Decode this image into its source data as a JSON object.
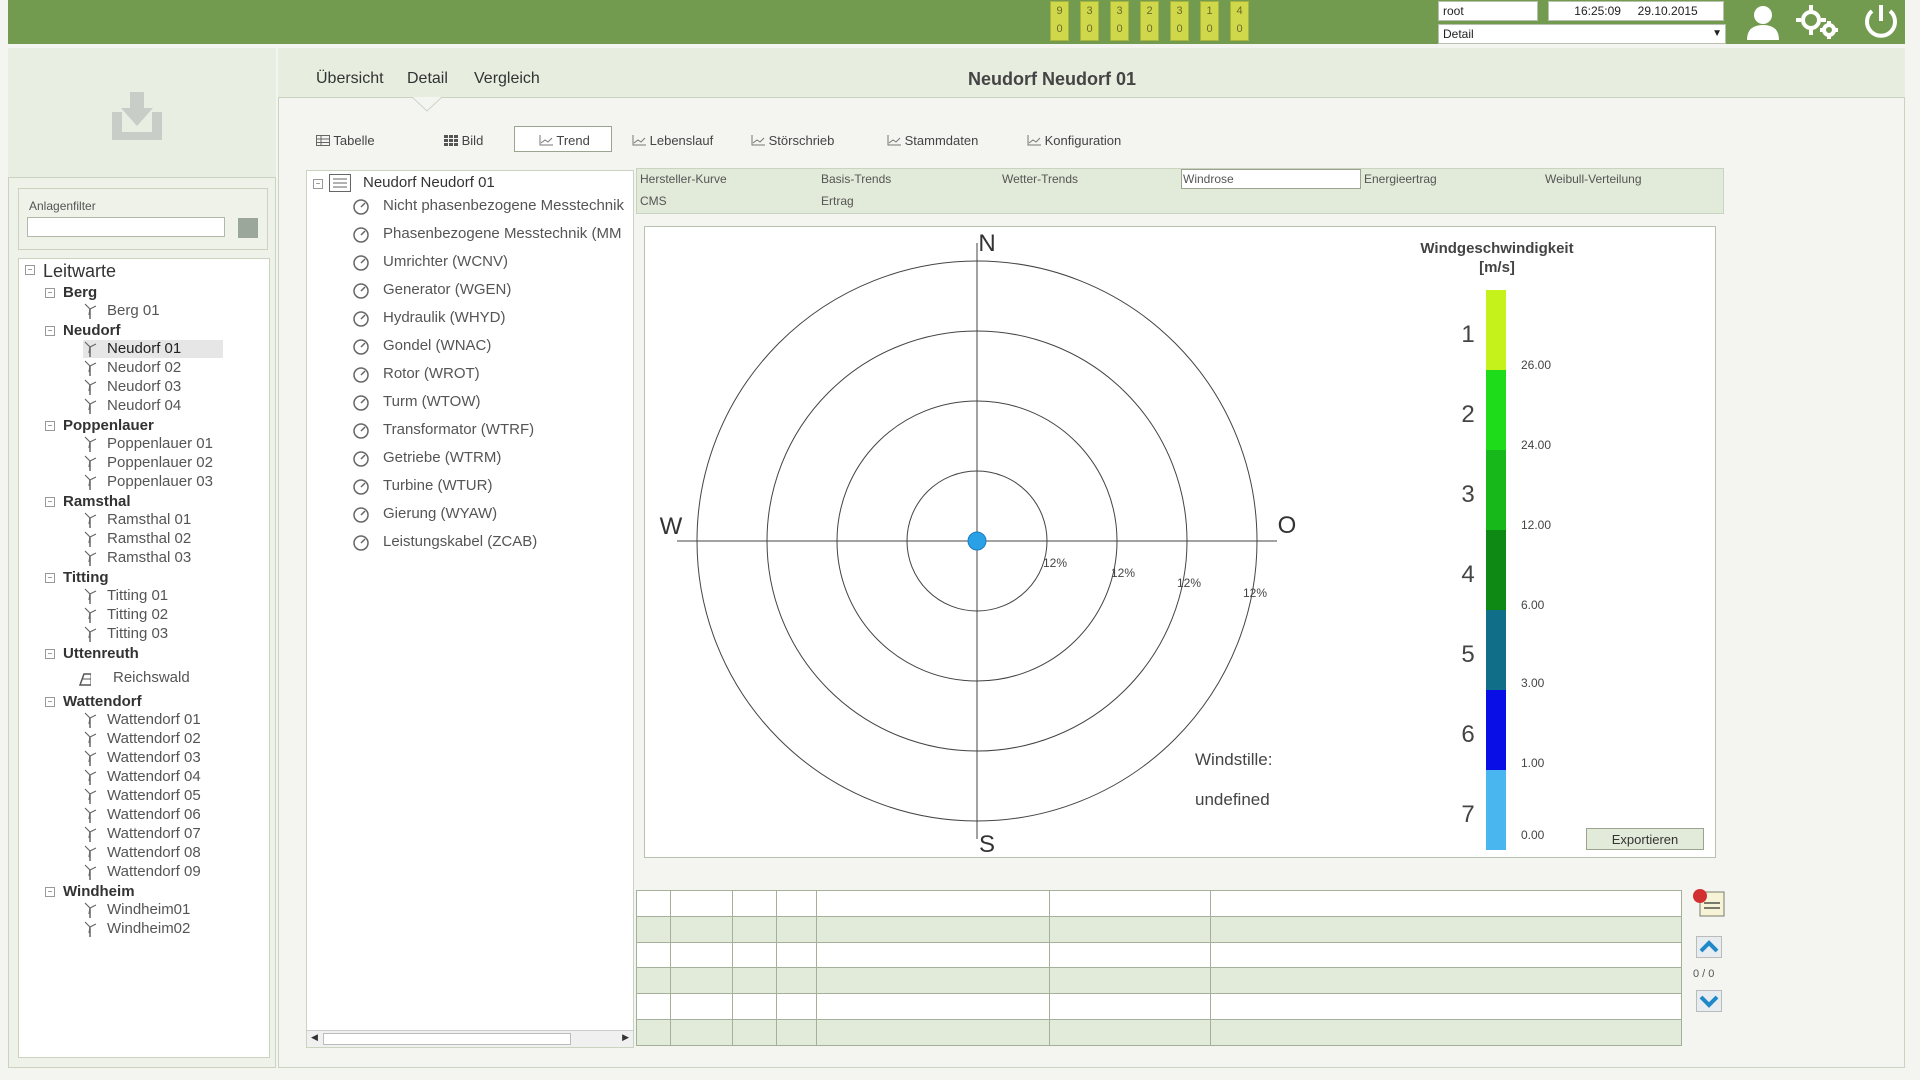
{
  "header": {
    "counters": [
      {
        "top": "9",
        "bottom": "0"
      },
      {
        "top": "3",
        "bottom": "0"
      },
      {
        "top": "3",
        "bottom": "0"
      },
      {
        "top": "2",
        "bottom": "0"
      },
      {
        "top": "3",
        "bottom": "0"
      },
      {
        "top": "1",
        "bottom": "0"
      },
      {
        "top": "4",
        "bottom": "0"
      }
    ],
    "user": "root",
    "time": "16:25:09",
    "date": "29.10.2015",
    "view_select": "Detail"
  },
  "filter": {
    "label": "Anlagenfilter",
    "value": ""
  },
  "tree": {
    "root": "Leitwarte",
    "groups": [
      {
        "name": "Berg",
        "items": [
          "Berg 01"
        ]
      },
      {
        "name": "Neudorf",
        "items": [
          "Neudorf 01",
          "Neudorf 02",
          "Neudorf 03",
          "Neudorf 04"
        ]
      },
      {
        "name": "Poppenlauer",
        "items": [
          "Poppenlauer 01",
          "Poppenlauer 02",
          "Poppenlauer 03"
        ]
      },
      {
        "name": "Ramsthal",
        "items": [
          "Ramsthal 01",
          "Ramsthal 02",
          "Ramsthal 03"
        ]
      },
      {
        "name": "Titting",
        "items": [
          "Titting 01",
          "Titting 02",
          "Titting 03"
        ]
      },
      {
        "name": "Uttenreuth",
        "items": [
          "Reichswald"
        ]
      },
      {
        "name": "Wattendorf",
        "items": [
          "Wattendorf 01",
          "Wattendorf 02",
          "Wattendorf 03",
          "Wattendorf 04",
          "Wattendorf 05",
          "Wattendorf 06",
          "Wattendorf 07",
          "Wattendorf 08",
          "Wattendorf 09"
        ]
      },
      {
        "name": "Windheim",
        "items": [
          "Windheim01",
          "Windheim02"
        ]
      }
    ],
    "selected": "Neudorf 01"
  },
  "nav": {
    "tabs": [
      "Übersicht",
      "Detail",
      "Vergleich"
    ],
    "active": "Detail"
  },
  "page_title": "Neudorf Neudorf 01",
  "subtabs": [
    "Tabelle",
    "Bild",
    "Trend",
    "Lebenslauf",
    "Störschrieb",
    "Stammdaten",
    "Konfiguration"
  ],
  "subtab_active": "Trend",
  "components": {
    "root": "Neudorf Neudorf 01",
    "items": [
      {
        "label": "Nicht phasenbezogene Messtechnik",
        "icon": "gauge-icon"
      },
      {
        "label": "Phasenbezogene Messtechnik (MM",
        "icon": "gauge-icon"
      },
      {
        "label": "Umrichter (WCNV)",
        "icon": "converter-icon"
      },
      {
        "label": "Generator (WGEN)",
        "icon": "generator-icon"
      },
      {
        "label": "Hydraulik (WHYD)",
        "icon": "hydraulic-icon"
      },
      {
        "label": "Gondel (WNAC)",
        "icon": "nacelle-icon"
      },
      {
        "label": "Rotor (WROT)",
        "icon": "rotor-icon"
      },
      {
        "label": "Turm (WTOW)",
        "icon": "tower-icon"
      },
      {
        "label": "Transformator (WTRF)",
        "icon": "transformer-icon"
      },
      {
        "label": "Getriebe (WTRM)",
        "icon": "gearbox-icon"
      },
      {
        "label": "Turbine (WTUR)",
        "icon": "turbine-icon"
      },
      {
        "label": "Gierung (WYAW)",
        "icon": "yaw-icon"
      },
      {
        "label": "Leistungskabel (ZCAB)",
        "icon": "cable-icon"
      }
    ]
  },
  "chart_tabs": {
    "row1": [
      "Hersteller-Kurve",
      "Basis-Trends",
      "Wetter-Trends",
      "Windrose",
      "Energieertrag",
      "Weibull-Verteilung"
    ],
    "row2": [
      "CMS",
      "Ertrag"
    ],
    "active": "Windrose"
  },
  "chart_data": {
    "type": "polar",
    "directions": [
      "N",
      "O",
      "S",
      "W"
    ],
    "rings": [
      "12%",
      "12%",
      "12%",
      "12%"
    ],
    "values": [],
    "calm_label": "Windstille:",
    "calm_value": "undefined",
    "legend": {
      "title_line1": "Windgeschwindigkeit",
      "title_line2": "[m/s]",
      "classes": [
        "1",
        "2",
        "3",
        "4",
        "5",
        "6",
        "7"
      ],
      "thresholds": [
        "26.00",
        "24.00",
        "12.00",
        "6.00",
        "3.00",
        "1.00",
        "0.00"
      ],
      "colors": [
        "#c5f21a",
        "#1fdc1a",
        "#17b81a",
        "#0e8a14",
        "#106e88",
        "#0a0ee6",
        "#4ab6f0"
      ]
    }
  },
  "export_label": "Exportieren",
  "paging": {
    "text": "0 / 0"
  },
  "colors": {
    "header_green": "#739b50",
    "tab_bg": "#e2ead9",
    "marker": "#2aa0e6"
  }
}
